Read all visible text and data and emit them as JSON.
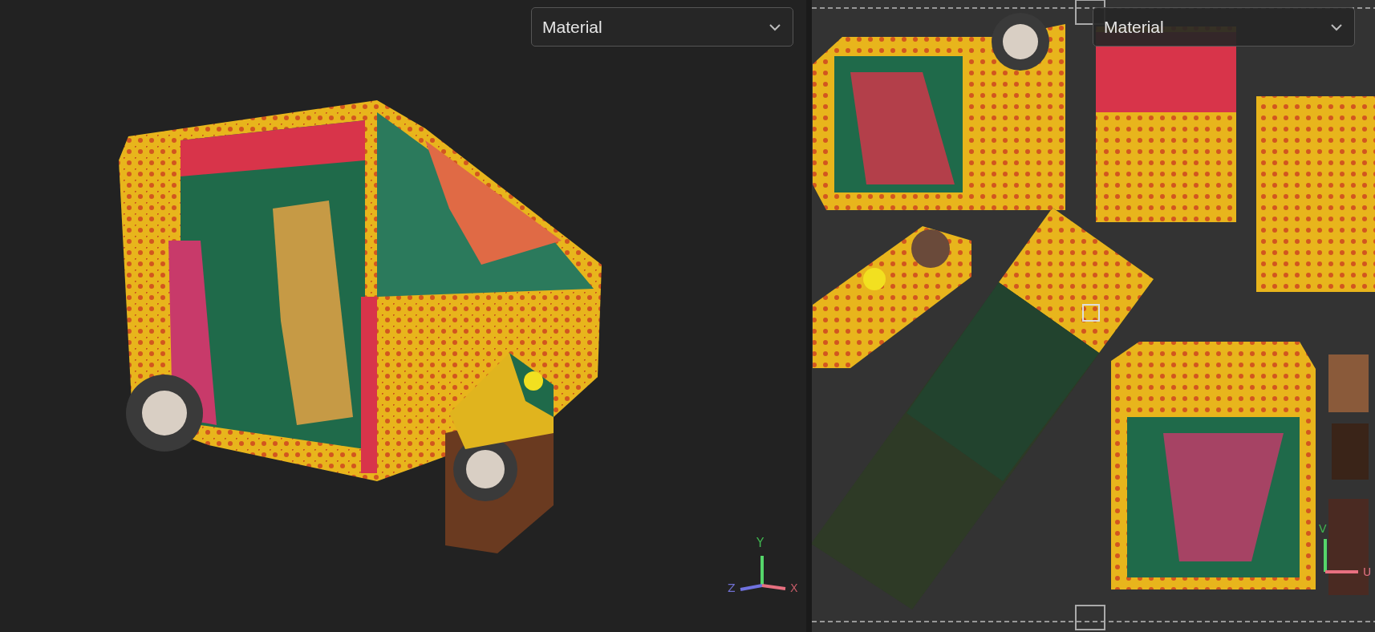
{
  "viewport_3d": {
    "shading_dropdown": {
      "value": "Material"
    },
    "axis_gizmo": {
      "labels": [
        "Y",
        "Z",
        "X"
      ]
    }
  },
  "uv_editor": {
    "shading_dropdown": {
      "value": "Material"
    },
    "axis_gizmo": {
      "labels": [
        "V",
        "U"
      ]
    }
  }
}
